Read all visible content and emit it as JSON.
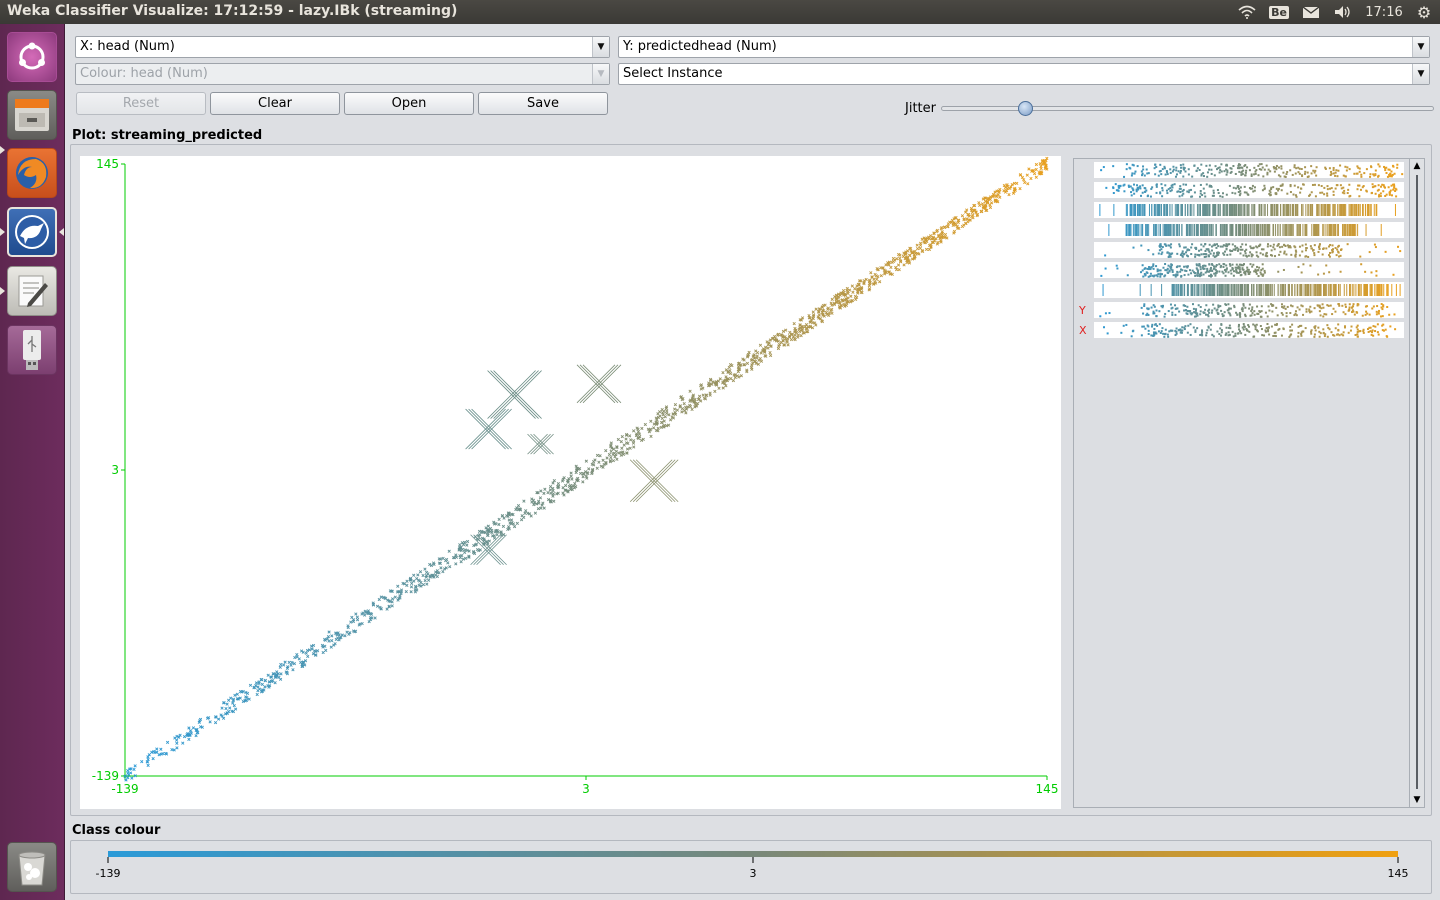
{
  "window": {
    "title": "Weka Classifier Visualize: 17:12:59 - lazy.IBk (streaming)"
  },
  "system": {
    "clock": "17:16",
    "indicators": [
      "wifi-icon",
      "keyboard-layout-icon",
      "mail-icon",
      "volume-icon",
      "settings-gear-icon"
    ],
    "keyboard_layout": "Be"
  },
  "launcher": {
    "items": [
      "ubuntu-dash",
      "files",
      "firefox",
      "weka",
      "text-editor",
      "usb-drive",
      "trash"
    ]
  },
  "controls": {
    "x_axis": "X: head (Num)",
    "y_axis": "Y: predictedhead (Num)",
    "colour": "Colour: head (Num)",
    "instance": "Select Instance",
    "reset": "Reset",
    "clear": "Clear",
    "open": "Open",
    "save": "Save",
    "jitter_label": "Jitter",
    "jitter_value": 0.17
  },
  "plot": {
    "title": "Plot: streaming_predicted",
    "x_ticks": [
      "-139",
      "3",
      "145"
    ],
    "y_ticks": [
      "145",
      "3",
      "-139"
    ],
    "axis_color": "#00cc00",
    "low_color": "#2a9ad8",
    "high_color": "#e8a020"
  },
  "chart_data": {
    "type": "scatter",
    "title": "Plot: streaming_predicted",
    "xlabel": "head",
    "ylabel": "predictedhead",
    "xlim": [
      -139,
      145
    ],
    "ylim": [
      -139,
      145
    ],
    "trend": {
      "from": [
        -139,
        -139
      ],
      "to": [
        145,
        145
      ]
    },
    "color_by": "head",
    "outliers_marked_with_large_x": [
      [
        -27,
        22
      ],
      [
        -19,
        38
      ],
      [
        -11,
        15
      ],
      [
        7,
        43
      ],
      [
        24,
        -2
      ],
      [
        -27,
        -34
      ]
    ]
  },
  "attribute_panel": {
    "y_marker": "Y",
    "x_marker": "X",
    "rows": 9
  },
  "class_colour": {
    "title": "Class colour",
    "ticks": [
      "-139",
      "3",
      "145"
    ],
    "low_color": "#2a9ad8",
    "high_color": "#f0a010"
  }
}
